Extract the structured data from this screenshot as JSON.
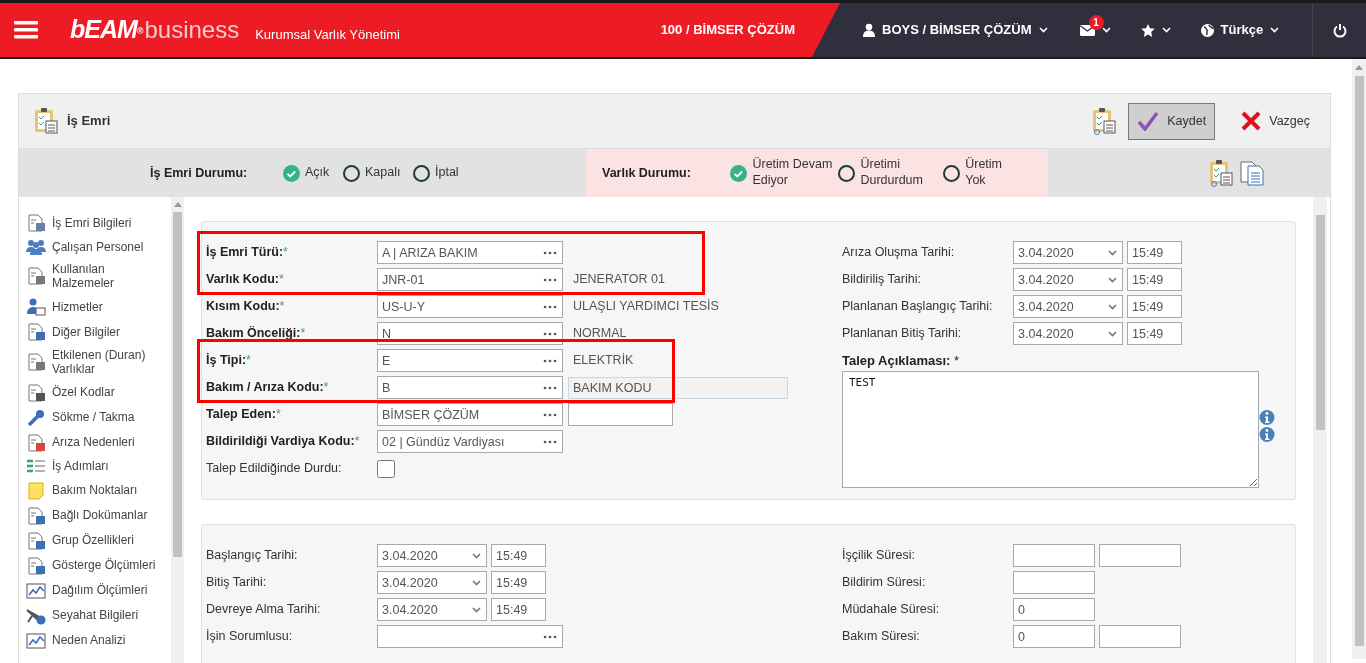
{
  "top_bar": {
    "logo": "bEAM$^{®}$",
    "logo_suffix": "business",
    "subtitle": "Kurumsal Varlık Yönetimi",
    "company": "100 / BİMSER ÇÖZÜM",
    "user": "BOYS / BİMSER ÇÖZÜM",
    "notifications": "1",
    "language": "Türkçe"
  },
  "form": {
    "title": "İş Emri",
    "buttons": [
      {
        "label": "Kaydet",
        "kind": "save"
      },
      {
        "label": "Vazgeç",
        "kind": "cancel"
      }
    ]
  },
  "status_groups": [
    {
      "label": "İş Emri Durumu:",
      "highlighted": false,
      "options": [
        {
          "label": "Açık",
          "selected": true
        },
        {
          "label": "Kapalı",
          "selected": false
        },
        {
          "label": "İptal",
          "selected": false
        }
      ]
    },
    {
      "label": "Varlık Durumu:",
      "highlighted": true,
      "options": [
        {
          "label": "Üretim Devam Ediyor",
          "selected": true
        },
        {
          "label": "Üretimi Durdurdum",
          "selected": false
        },
        {
          "label": "Üretim Yok",
          "selected": false
        }
      ]
    }
  ],
  "sidebar": {
    "items": [
      "İş Emri Bilgileri",
      "Çalışan Personel",
      "Kullanılan Malzemeler",
      "Hizmetler",
      "Diğer Bilgiler",
      "Etkilenen (Duran) Varlıklar",
      "Özel Kodlar",
      "Sökme / Takma",
      "Arıza Nedenleri",
      "İş Adımları",
      "Bakım Noktaları",
      "Bağlı Dokümanlar",
      "Grup Özellikleri",
      "Gösterge Ölçümleri",
      "Dağılım Ölçümleri",
      "Seyahat Bilgileri",
      "Neden Analizi"
    ]
  },
  "general_section": {
    "field_groups": [
      {
        "outlined": true,
        "fields": [
          {
            "kind": "lookup",
            "label": "İş Emri Türü:",
            "required": true,
            "mark": "*",
            "value": "A | ARIZA BAKIM"
          },
          {
            "kind": "lookup",
            "label": "Varlık Kodu:",
            "required": true,
            "mark": "*",
            "value": "JNR-01",
            "description": "JENERATOR 01"
          }
        ]
      },
      {
        "outlined": false,
        "fields": [
          {
            "kind": "lookup",
            "label": "Kısım Kodu:",
            "required": true,
            "mark": "*",
            "value": "US-U-Y",
            "description": "ULAŞLI YARDIMCI TESİS"
          },
          {
            "kind": "lookup",
            "label": "Bakım Önceliği:",
            "required": true,
            "mark": "*",
            "value": "N",
            "description": "NORMAL"
          }
        ]
      },
      {
        "outlined": true,
        "fields": [
          {
            "kind": "lookup",
            "label": "İş Tipi:",
            "required": true,
            "mark": "*",
            "value": "E",
            "description": "ELEKTRİK"
          },
          {
            "kind": "lookup",
            "label": "Bakım / Arıza Kodu:",
            "required": true,
            "mark": "*",
            "value": "B",
            "description_field": "BAKIM KODU"
          }
        ]
      },
      {
        "outlined": false,
        "fields": [
          {
            "kind": "lookup",
            "label": "Talep Eden:",
            "required": true,
            "mark": "*",
            "value": "BİMSER ÇÖZÜM",
            "extra_input": true
          },
          {
            "kind": "lookup",
            "label": "Bildirildiği Vardiya Kodu:",
            "required": true,
            "mark": "*",
            "value": "02 | Gündüz Vardiyası"
          },
          {
            "kind": "checkbox",
            "label": "Talep Edildiğinde Durdu:",
            "required": false,
            "checked": false
          }
        ]
      }
    ],
    "dates": [
      {
        "label": "Arıza Oluşma Tarihi:",
        "date": "3.04.2020",
        "time": "15:49"
      },
      {
        "label": "Bildiriliş Tarihi:",
        "date": "3.04.2020",
        "time": "15:49"
      },
      {
        "label": "Planlanan Başlangıç Tarihi:",
        "date": "3.04.2020",
        "time": "15:49"
      },
      {
        "label": "Planlanan Bitiş Tarihi:",
        "date": "3.04.2020",
        "time": "15:49"
      }
    ],
    "request": {
      "label": "Talep Açıklaması:",
      "mark": "*",
      "value": "TEST"
    }
  },
  "time_section": {
    "fields": [
      {
        "kind": "datetime",
        "label": "Başlangıç Tarihi:",
        "date": "3.04.2020",
        "time": "15:49"
      },
      {
        "kind": "datetime",
        "label": "Bitiş Tarihi:",
        "date": "3.04.2020",
        "time": "15:49"
      },
      {
        "kind": "datetime",
        "label": "Devreye Alma Tarihi:",
        "date": "3.04.2020",
        "time": "15:49"
      },
      {
        "kind": "lookup",
        "label": "İşin Sorumlusu:"
      }
    ],
    "durations": [
      {
        "label": "İşçilik Süresi:",
        "inputs": [
          {
            "kind": "text"
          },
          {
            "kind": "text"
          }
        ]
      },
      {
        "label": "Bildirim Süresi:",
        "inputs": [
          {
            "kind": "text"
          }
        ]
      },
      {
        "label": "Müdahale Süresi:",
        "inputs": [
          {
            "kind": "text",
            "value": "0"
          }
        ]
      },
      {
        "label": "Bakım Süresi:",
        "inputs": [
          {
            "kind": "text",
            "value": "0"
          },
          {
            "kind": "text"
          }
        ]
      }
    ]
  }
}
